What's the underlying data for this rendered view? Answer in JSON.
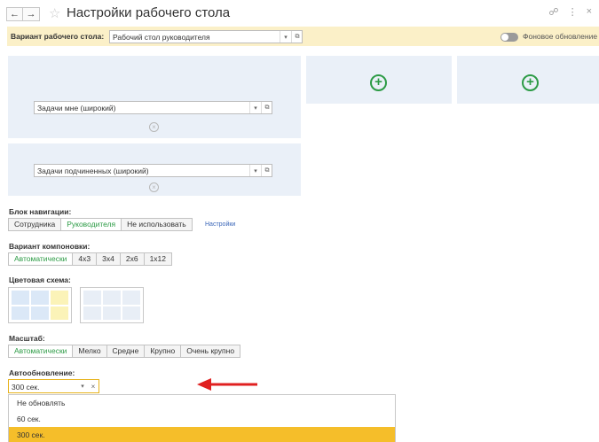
{
  "window": {
    "title": "Настройки рабочего стола"
  },
  "variant_bar": {
    "label": "Вариант рабочего стола:",
    "value": "Рабочий стол руководителя",
    "background_update_label": "Фоновое обновление",
    "background_update_suffix": "?"
  },
  "panels": {
    "left": [
      {
        "value": "Задачи мне (широкий)"
      },
      {
        "value": "Задачи подчиненных (широкий)"
      }
    ]
  },
  "navigation_block": {
    "label": "Блок навигации:",
    "options": [
      "Сотрудника",
      "Руководителя",
      "Не использовать"
    ],
    "selected": "Руководителя",
    "settings_link": "Настройки"
  },
  "layout_variant": {
    "label": "Вариант компоновки:",
    "options": [
      "Автоматически",
      "4x3",
      "3x4",
      "2x6",
      "1x12"
    ],
    "selected": "Автоматически"
  },
  "color_scheme": {
    "label": "Цветовая схема:"
  },
  "scale": {
    "label": "Масштаб:",
    "options": [
      "Автоматически",
      "Мелко",
      "Средне",
      "Крупно",
      "Очень крупно"
    ],
    "selected": "Автоматически"
  },
  "auto_update": {
    "label": "Автообновление:",
    "value": "300 сек.",
    "options": [
      "Не обновлять",
      "60 сек.",
      "300 сек."
    ],
    "selected": "300 сек."
  },
  "colors": {
    "accent_green": "#2c9b45",
    "variant_bar_bg": "#fbf0c8",
    "selected_option": "#f5be2a",
    "annotation_arrow": "#e02020"
  }
}
